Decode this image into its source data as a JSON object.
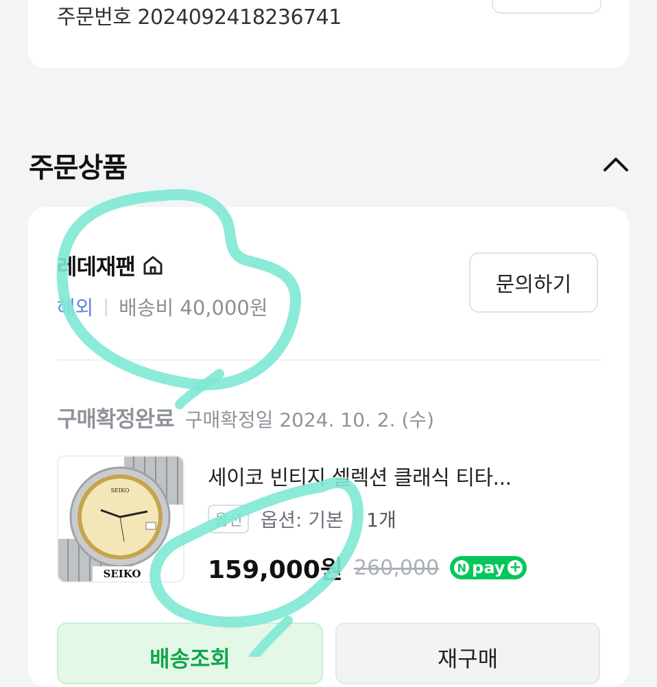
{
  "order": {
    "order_number_text": "주문번호 2024092418236741"
  },
  "section": {
    "title": "주문상품"
  },
  "seller": {
    "name": "레데재팬",
    "region": "해외",
    "shipping_fee": "배송비 40,000원",
    "inquiry_label": "문의하기"
  },
  "item": {
    "status": "구매확정완료",
    "confirm_date": "구매확정일 2024. 10. 2. (수)",
    "product_name": "세이코 빈티지 셀렉션 클래식 티타...",
    "option_badge": "옵션",
    "option_text": "옵션: 기본",
    "quantity": "1개",
    "price": "159,000원",
    "original_price": "260,000",
    "npay_label": "pay",
    "thumb_brand": "SEIKO"
  },
  "actions": {
    "track_label": "배송조회",
    "rebuy_label": "재구매"
  },
  "colors": {
    "accent_green": "#03c75a",
    "overseas_blue": "#5a87e0",
    "annotation": "#7ee8d4"
  }
}
